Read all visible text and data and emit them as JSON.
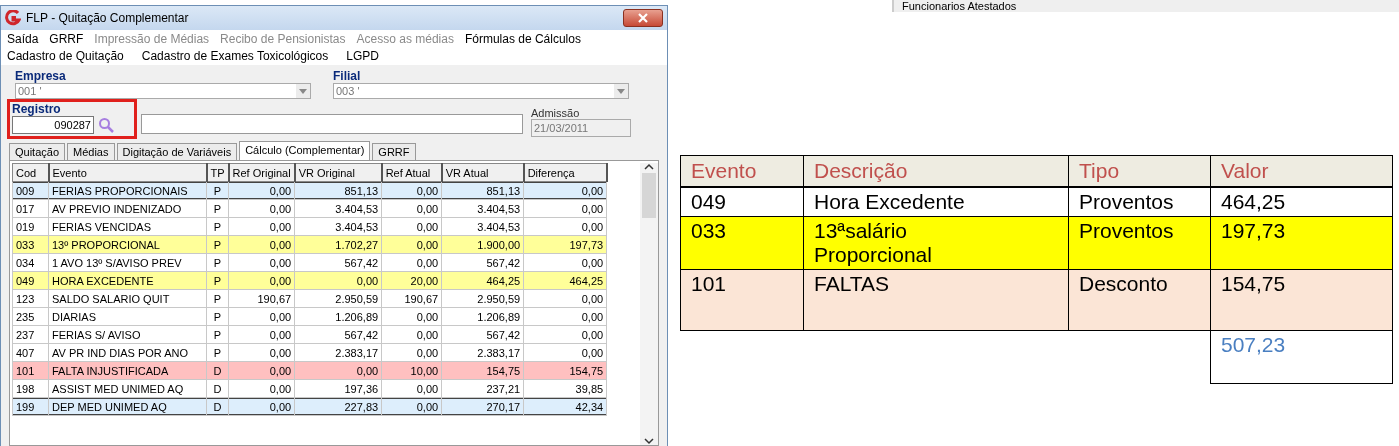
{
  "window": {
    "title": "FLP - Quitação Complementar"
  },
  "menu": [
    [
      {
        "label": "Saída",
        "disabled": false
      },
      {
        "label": "GRRF",
        "disabled": false
      },
      {
        "label": "Impressão de Médias",
        "disabled": true
      },
      {
        "label": "Recibo de Pensionistas",
        "disabled": true
      },
      {
        "label": "Acesso as médias",
        "disabled": true
      },
      {
        "label": "Fórmulas de Cálculos",
        "disabled": false
      }
    ],
    [
      {
        "label": "Cadastro de Quitação",
        "disabled": false
      },
      {
        "label": "Cadastro de Exames Toxicológicos",
        "disabled": false
      },
      {
        "label": "LGPD",
        "disabled": false
      }
    ]
  ],
  "form": {
    "empresa": {
      "label": "Empresa",
      "value": "001 '"
    },
    "filial": {
      "label": "Filial",
      "value": "003 '"
    },
    "registro": {
      "label": "Registro",
      "value": "090287"
    },
    "admissao": {
      "label": "Admissão",
      "value": "21/03/2011"
    }
  },
  "tabs": [
    {
      "label": "Quitação",
      "selected": false
    },
    {
      "label": "Médias",
      "selected": false
    },
    {
      "label": "Digitação de Variáveis",
      "selected": false
    },
    {
      "label": "Cálculo (Complementar)",
      "selected": true
    },
    {
      "label": "GRRF",
      "selected": false
    }
  ],
  "grid": {
    "columns": [
      "Cod",
      "Evento",
      "TP",
      "Ref Original",
      "VR Original",
      "Ref Atual",
      "VR Atual",
      "Diferença"
    ],
    "rows": [
      {
        "cells": [
          "009",
          "FERIAS PROPORCIONAIS",
          "P",
          "0,00",
          "851,13",
          "0,00",
          "851,13",
          "0,00"
        ],
        "selected": true,
        "color": "#ddeefc"
      },
      {
        "cells": [
          "017",
          "AV PREVIO INDENIZADO",
          "P",
          "0,00",
          "3.404,53",
          "0,00",
          "3.404,53",
          "0,00"
        ],
        "selected": false,
        "color": "#ffffff"
      },
      {
        "cells": [
          "019",
          "FERIAS VENCIDAS",
          "P",
          "0,00",
          "3.404,53",
          "0,00",
          "3.404,53",
          "0,00"
        ],
        "selected": false,
        "color": "#ffffff"
      },
      {
        "cells": [
          "033",
          "13º PROPORCIONAL",
          "P",
          "0,00",
          "1.702,27",
          "0,00",
          "1.900,00",
          "197,73"
        ],
        "selected": false,
        "color": "#ffff99"
      },
      {
        "cells": [
          "034",
          "1 AVO 13º S/AVISO PREV",
          "P",
          "0,00",
          "567,42",
          "0,00",
          "567,42",
          "0,00"
        ],
        "selected": false,
        "color": "#ffffff"
      },
      {
        "cells": [
          "049",
          "HORA EXCEDENTE",
          "P",
          "0,00",
          "0,00",
          "20,00",
          "464,25",
          "464,25"
        ],
        "selected": false,
        "color": "#ffff99"
      },
      {
        "cells": [
          "123",
          "SALDO SALARIO QUIT",
          "P",
          "190,67",
          "2.950,59",
          "190,67",
          "2.950,59",
          "0,00"
        ],
        "selected": false,
        "color": "#ffffff"
      },
      {
        "cells": [
          "235",
          "DIARIAS",
          "P",
          "0,00",
          "1.206,89",
          "0,00",
          "1.206,89",
          "0,00"
        ],
        "selected": false,
        "color": "#ffffff"
      },
      {
        "cells": [
          "237",
          "FERIAS S/ AVISO",
          "P",
          "0,00",
          "567,42",
          "0,00",
          "567,42",
          "0,00"
        ],
        "selected": false,
        "color": "#ffffff"
      },
      {
        "cells": [
          "407",
          "AV PR IND DIAS POR ANO",
          "P",
          "0,00",
          "2.383,17",
          "0,00",
          "2.383,17",
          "0,00"
        ],
        "selected": false,
        "color": "#ffffff"
      },
      {
        "cells": [
          "101",
          "FALTA INJUSTIFICADA",
          "D",
          "0,00",
          "0,00",
          "10,00",
          "154,75",
          "154,75"
        ],
        "selected": false,
        "color": "#ffc0c0"
      },
      {
        "cells": [
          "198",
          "ASSIST MED UNIMED AQ",
          "D",
          "0,00",
          "197,36",
          "0,00",
          "237,21",
          "39,85"
        ],
        "selected": false,
        "color": "#ffffff"
      },
      {
        "cells": [
          "199",
          "DEP MED UNIMED AQ",
          "D",
          "0,00",
          "227,83",
          "0,00",
          "270,17",
          "42,34"
        ],
        "selected": true,
        "color": "#ddeefc"
      }
    ]
  },
  "background_tab": {
    "label": "Funcionarios Atestados"
  },
  "summary": {
    "columns": [
      "Evento",
      "Descrição",
      "Tipo",
      "Valor"
    ],
    "rows": [
      {
        "cells": [
          "049",
          "Hora Excedente",
          "Proventos",
          "464,25"
        ],
        "color": "#ffffff"
      },
      {
        "cells": [
          "033",
          "13ªsalário Proporcional",
          "Proventos",
          "197,73"
        ],
        "color": "#ffff00"
      },
      {
        "cells": [
          "101",
          "FALTAS",
          "Desconto",
          "154,75"
        ],
        "color": "#fbe5d6"
      }
    ],
    "total": "507,23"
  }
}
